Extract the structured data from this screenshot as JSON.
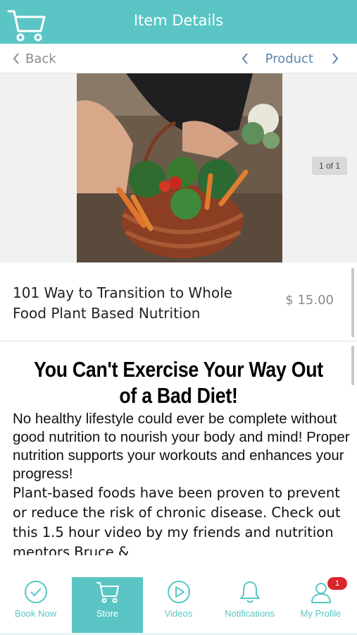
{
  "header": {
    "title": "Item Details",
    "cart_icon": "cart-icon"
  },
  "subnav": {
    "back_label": "Back",
    "product_label": "Product"
  },
  "gallery": {
    "counter": "1 of 1"
  },
  "product": {
    "name": "101 Way to Transition to Whole Food Plant Based Nutrition",
    "price": "$ 15.00"
  },
  "description": {
    "headline": "You Can't  Exercise Your Way Out of a Bad Diet!",
    "paragraph1": "No healthy lifestyle could ever be complete without good nutrition to nourish your body and mind! Proper nutrition supports your workouts and enhances your progress!",
    "paragraph2": "Plant-based foods have been proven to prevent or reduce the risk of chronic disease. Check out this 1.5 hour video by my friends and nutrition mentors Bruce &"
  },
  "tabs": [
    {
      "label": "Book Now",
      "icon": "check-circle-icon"
    },
    {
      "label": "Store",
      "icon": "cart-icon",
      "active": true
    },
    {
      "label": "Videos",
      "icon": "play-circle-icon"
    },
    {
      "label": "Notifications",
      "icon": "bell-icon"
    },
    {
      "label": "My Profile",
      "icon": "user-icon",
      "badge": "1"
    }
  ],
  "colors": {
    "brand": "#5bc5c5",
    "link": "#5b86b0",
    "badge": "#d8262b"
  }
}
